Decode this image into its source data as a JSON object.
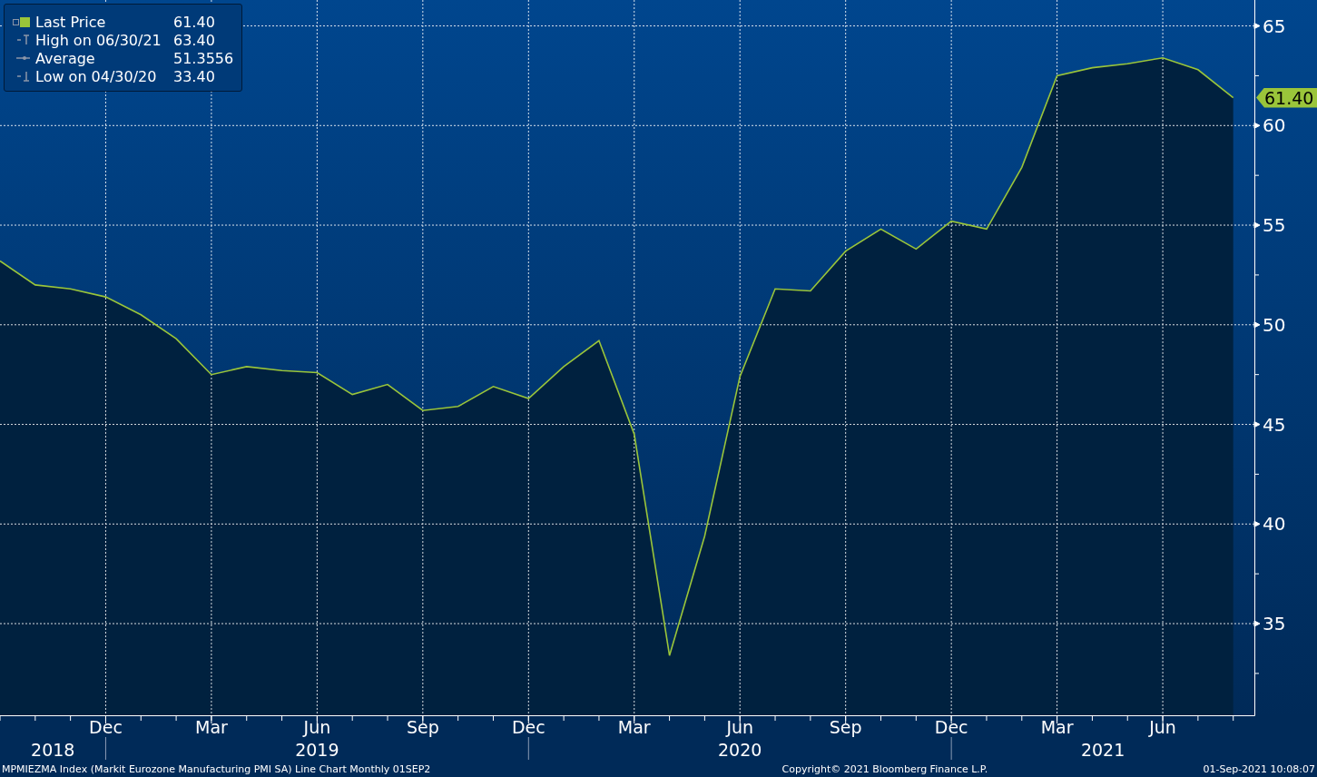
{
  "legend": [
    {
      "kind": "last",
      "value": "61.40"
    },
    {
      "kind": "high",
      "label": "High on 06/30/21",
      "value": "63.40"
    },
    {
      "kind": "average",
      "label": "Average",
      "value": "51.3556"
    },
    {
      "kind": "low",
      "label": "Low on 04/30/20",
      "value": "33.40"
    }
  ],
  "chart": {
    "last_price_tag": "61.40",
    "year_labels": [
      "2018",
      "2019",
      "2020",
      "2021"
    ],
    "chart_data": {
      "type": "line",
      "categories": [
        null,
        null,
        null,
        "Dec",
        null,
        null,
        "Mar",
        null,
        null,
        "Jun",
        null,
        null,
        "Sep",
        null,
        null,
        "Dec",
        null,
        null,
        "Mar",
        null,
        null,
        "Jun",
        null,
        null,
        "Sep",
        null,
        null,
        "Dec",
        null,
        null,
        "Mar",
        null,
        null,
        "Jun",
        null,
        null
      ],
      "series": [
        {
          "name": "Last Price",
          "color": "#9ac53a",
          "values": [
            53.2,
            52.0,
            51.8,
            51.4,
            50.5,
            49.3,
            47.5,
            47.9,
            47.7,
            47.6,
            46.5,
            47.0,
            45.7,
            45.9,
            46.9,
            46.3,
            47.9,
            49.2,
            44.5,
            33.4,
            39.4,
            47.4,
            51.8,
            51.7,
            53.7,
            54.8,
            53.8,
            55.2,
            54.8,
            57.9,
            62.5,
            62.9,
            63.1,
            63.4,
            62.8,
            61.4
          ]
        }
      ],
      "ylim": [
        30.4,
        66.3
      ],
      "yticks": [
        35,
        40,
        45,
        50,
        55,
        60,
        65
      ],
      "grid": true
    }
  },
  "footer": {
    "description": "MPMIEZMA Index (Markit Eurozone Manufacturing PMI SA) Line Chart  Monthly 01SEP2",
    "copyright": "Copyright© 2021 Bloomberg Finance L.P.",
    "timestamp": "01-Sep-2021 10:08:07"
  }
}
